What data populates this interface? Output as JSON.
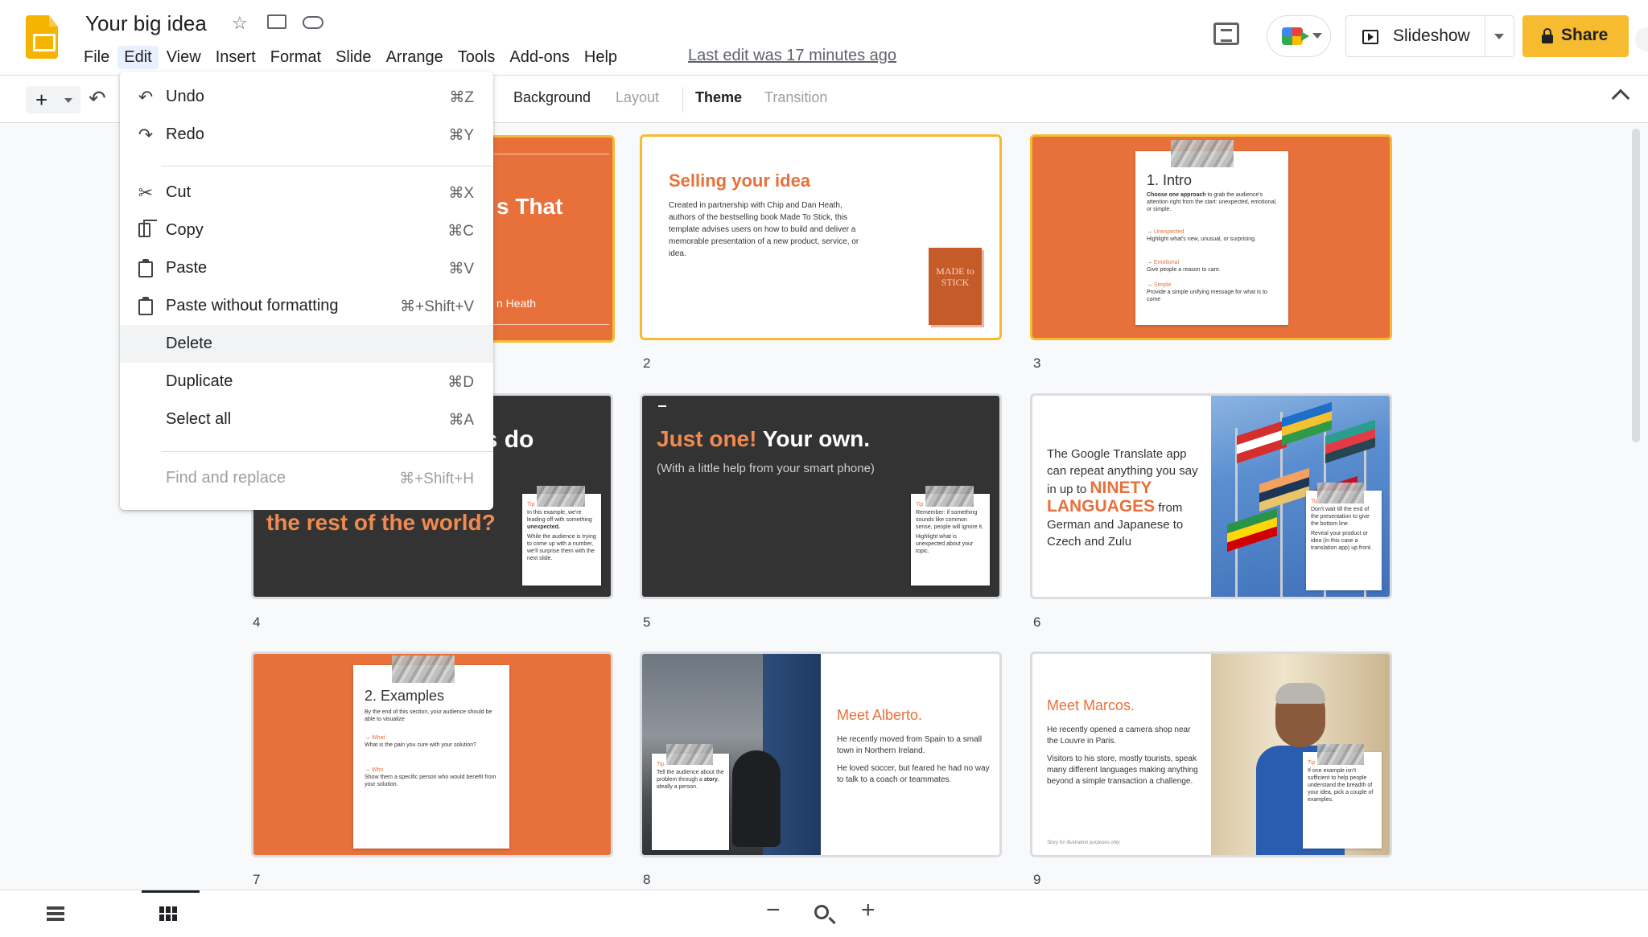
{
  "header": {
    "title": "Your big idea",
    "last_edit": "Last edit was 17 minutes ago",
    "slideshow_label": "Slideshow",
    "share_label": "Share",
    "menus": [
      "File",
      "Edit",
      "View",
      "Insert",
      "Format",
      "Slide",
      "Arrange",
      "Tools",
      "Add-ons",
      "Help"
    ],
    "active_menu": "Edit",
    "icons": [
      "star-icon",
      "move-to-folder-icon",
      "cloud-saved-icon",
      "comment-icon",
      "meet-icon",
      "lock-icon"
    ]
  },
  "toolbar": {
    "background": "Background",
    "layout": "Layout",
    "theme": "Theme",
    "transition": "Transition"
  },
  "edit_menu": {
    "items": [
      {
        "label": "Undo",
        "shortcut": "⌘Z"
      },
      {
        "label": "Redo",
        "shortcut": "⌘Y"
      },
      {
        "label": "Cut",
        "shortcut": "⌘X"
      },
      {
        "label": "Copy",
        "shortcut": "⌘C"
      },
      {
        "label": "Paste",
        "shortcut": "⌘V"
      },
      {
        "label": "Paste without formatting",
        "shortcut": "⌘+Shift+V"
      },
      {
        "label": "Delete",
        "shortcut": ""
      },
      {
        "label": "Duplicate",
        "shortcut": "⌘D"
      },
      {
        "label": "Select all",
        "shortcut": "⌘A"
      },
      {
        "label": "Find and replace",
        "shortcut": "⌘+Shift+H"
      }
    ]
  },
  "slides": {
    "numbers": [
      "2",
      "3",
      "4",
      "5",
      "6",
      "7",
      "8",
      "9"
    ],
    "s1": {
      "title": "s That",
      "author": "n Heath"
    },
    "s2": {
      "title": "Selling your idea",
      "body": "Created in partnership with Chip and Dan Heath, authors of the bestselling book Made To Stick, this template advises users on how to build and deliver a memorable presentation of a new product, service, or idea.",
      "book": "MADE to STICK"
    },
    "s3": {
      "heading": "1. Intro",
      "lead_bold": "Choose one approach",
      "lead_rest": " to grab the audience's attention right from the start: unexpected, emotional, or simple.",
      "items": [
        {
          "title": "Unexpected",
          "text": "Highlight what's new, unusual, or surprising."
        },
        {
          "title": "Emotional",
          "text": "Give people a reason to care."
        },
        {
          "title": "Simple",
          "text": "Provide a simple unifying message for what is to come"
        }
      ]
    },
    "s4": {
      "title": "es do",
      "subtitle": "the rest of the world?",
      "tip_label": "Tip",
      "tip_a": "In this example, we're leading off with something ",
      "tip_bold": "unexpected.",
      "tip_b": "While the audience is trying to come up with a number, we'll surprise them with the next slide."
    },
    "s5": {
      "title_accent": "Just one!",
      "title_rest": " Your own.",
      "subtitle": "(With a little help from your smart phone)",
      "tip_label": "Tip",
      "tip_a": "Remember: if something sounds like common sense, people will ignore it.",
      "tip_b": "Highlight what is unexpected about your topic."
    },
    "s6": {
      "text_a": "The Google Translate app can repeat anything you say in up to ",
      "text_big": "NINETY LANGUAGES",
      "text_b": " from German and Japanese  to Czech and Zulu",
      "tip_label": "Tip",
      "tip_a": "Don't wait till the end of the presentation to give the bottom line.",
      "tip_b": "Reveal your product or idea (in this case a translation app) up front."
    },
    "s7": {
      "heading": "2. Examples",
      "lead": "By the end of this section, your audience should be able to visualize",
      "items": [
        {
          "title": "What",
          "text": "What is the pain you cure with your solution?"
        },
        {
          "title": "Who",
          "text": "Show them a specific person who would benefit from your solution."
        }
      ]
    },
    "s8": {
      "title": "Meet Alberto.",
      "body_a": "He recently moved from Spain to a small town in Northern Ireland.",
      "body_b": "He loved soccer, but feared he had no way to talk to a coach or teammates.",
      "tip_label": "Tip",
      "tip_a": "Tell the audience about the problem through a ",
      "tip_bold": "story",
      "tip_b": ", ideally a person."
    },
    "s9": {
      "title": "Meet Marcos.",
      "body_a": "He recently opened a camera shop near the Louvre in Paris.",
      "body_b": "Visitors to his store, mostly tourists, speak many different languages making anything beyond a simple transaction a challenge.",
      "footnote": "Story for illustration purposes only",
      "tip_label": "Tip",
      "tip_a": "If one example isn't sufficient to help people understand the breadth of your idea, pick a couple of examples."
    }
  },
  "colors": {
    "accent": "#e8703a",
    "share": "#f6bb2e",
    "dark_slide": "#333333",
    "selected_border": "#f6bb2e"
  }
}
